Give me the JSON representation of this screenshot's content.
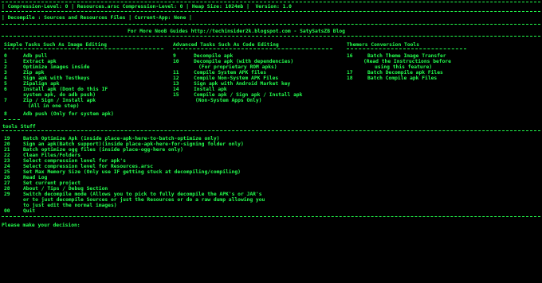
{
  "status": {
    "line1": "| Compression-Level: 0 | Resources.arsc Compression-Level: 0 | Heap Size: 1024mb |  Version: 1.0",
    "line2": "| Decompile : Sources and Resources Files | Current-App: None |"
  },
  "guide_banner": "For More NooB Guides http://techinsider2k.blogspot.com - SatySatsZB Blog",
  "sections": {
    "simple": "Simple Tasks Such As Image Editing",
    "advanced": "Advanced Tasks Such As Code Editing",
    "themers": "Themers Conversion Tools"
  },
  "simple_items": [
    {
      "num": "0",
      "label": "Adb pull"
    },
    {
      "num": "1",
      "label": "Extract apk"
    },
    {
      "num": "2",
      "label": "Optimize images inside"
    },
    {
      "num": "3",
      "label": "Zip apk"
    },
    {
      "num": "4",
      "label": "Sign apk with Testkeys"
    },
    {
      "num": "5",
      "label": "Zipalign apk"
    },
    {
      "num": "6",
      "label": "Install apk (Dont do this IF"
    },
    {
      "num": "",
      "label": "system apk, do adb push)"
    },
    {
      "num": "7",
      "label": "Zip / Sign / Install apk"
    },
    {
      "num": "",
      "label": "(All in one step)"
    },
    {
      "num": "8",
      "label": "Adb push (Only for system apk)"
    }
  ],
  "advanced_items": [
    {
      "num": "9",
      "label": "Decompile apk"
    },
    {
      "num": "10",
      "label": "Decompile apk (with dependencies)"
    },
    {
      "num": "",
      "label": "(For proprietary ROM apks)"
    },
    {
      "num": "11",
      "label": "Compile System APK files"
    },
    {
      "num": "12",
      "label": "Compile Non-System APK Files"
    },
    {
      "num": "13",
      "label": "Sign apk with Android Market key"
    },
    {
      "num": "14",
      "label": "Install apk"
    },
    {
      "num": "15",
      "label": "Compile apk / Sign apk / Install apk"
    },
    {
      "num": "",
      "label": "(Non-System Apps Only)"
    }
  ],
  "themer_items": [
    {
      "num": "16",
      "label": "Batch Theme Image Transfer"
    },
    {
      "num": "",
      "label": "(Read the Instructions before"
    },
    {
      "num": "",
      "label": "using this feature)"
    },
    {
      "num": "17",
      "label": "Batch Decompile apk Files"
    },
    {
      "num": "18",
      "label": "Batch Compile apk Files"
    }
  ],
  "tools_title": "tools Stuff",
  "tool_items": [
    {
      "num": "19",
      "label": "Batch Optimize Apk (inside place-apk-here-to-batch-optimize only)"
    },
    {
      "num": "20",
      "label": "Sign an apk(Batch support)(inside place-apk-here-for-signing folder only)"
    },
    {
      "num": "21",
      "label": "Batch optimize ogg files (inside place-ogg-here only)"
    },
    {
      "num": "22",
      "label": "Clean Files/Folders"
    },
    {
      "num": "23",
      "label": "Select compression level for apk's"
    },
    {
      "num": "24",
      "label": "Select compression level for Resources.arsc"
    },
    {
      "num": "25",
      "label": "Set Max Memory Size (Only use IF getting stuck at decompiling/compiling)"
    },
    {
      "num": "26",
      "label": "Read Log"
    },
    {
      "num": "27",
      "label": "Set current project"
    },
    {
      "num": "28",
      "label": "About / Tips / Debug Section"
    },
    {
      "num": "29",
      "label": "Switch decompile mode (Allows you to pick to fully decompile the APK's or JAR's"
    },
    {
      "num": "",
      "label": "or to just decompile Sources or just the Resources or do a raw dump allowing you"
    },
    {
      "num": "",
      "label": "to just edit the normal images)"
    },
    {
      "num": "00",
      "label": "Quit"
    }
  ],
  "prompt": "Please make your decision:"
}
